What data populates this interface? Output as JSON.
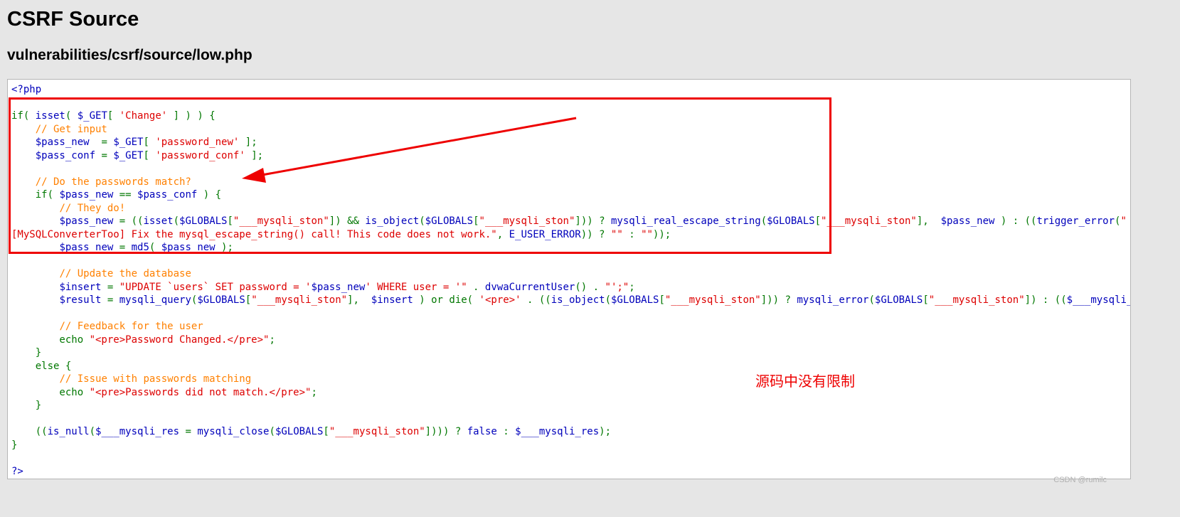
{
  "page": {
    "title": "CSRF Source",
    "subtitle": "vulnerabilities/csrf/source/low.php"
  },
  "code_lines": [
    [
      {
        "t": "<?php",
        "c": "def"
      }
    ],
    [],
    [
      {
        "t": "if( ",
        "c": "kw"
      },
      {
        "t": "isset",
        "c": "def"
      },
      {
        "t": "( ",
        "c": "kw"
      },
      {
        "t": "$_GET",
        "c": "def"
      },
      {
        "t": "[ ",
        "c": "kw"
      },
      {
        "t": "'Change'",
        "c": "str"
      },
      {
        "t": " ] ) ) {",
        "c": "kw"
      }
    ],
    [
      {
        "t": "    ",
        "c": "kw"
      },
      {
        "t": "// Get input",
        "c": "cmt"
      }
    ],
    [
      {
        "t": "    ",
        "c": "kw"
      },
      {
        "t": "$pass_new ",
        "c": "def"
      },
      {
        "t": " = ",
        "c": "kw"
      },
      {
        "t": "$_GET",
        "c": "def"
      },
      {
        "t": "[ ",
        "c": "kw"
      },
      {
        "t": "'password_new'",
        "c": "str"
      },
      {
        "t": " ];",
        "c": "kw"
      }
    ],
    [
      {
        "t": "    ",
        "c": "kw"
      },
      {
        "t": "$pass_conf",
        "c": "def"
      },
      {
        "t": " = ",
        "c": "kw"
      },
      {
        "t": "$_GET",
        "c": "def"
      },
      {
        "t": "[ ",
        "c": "kw"
      },
      {
        "t": "'password_conf'",
        "c": "str"
      },
      {
        "t": " ];",
        "c": "kw"
      }
    ],
    [],
    [
      {
        "t": "    ",
        "c": "kw"
      },
      {
        "t": "// Do the passwords match?",
        "c": "cmt"
      }
    ],
    [
      {
        "t": "    if( ",
        "c": "kw"
      },
      {
        "t": "$pass_new",
        "c": "def"
      },
      {
        "t": " == ",
        "c": "kw"
      },
      {
        "t": "$pass_conf",
        "c": "def"
      },
      {
        "t": " ) {",
        "c": "kw"
      }
    ],
    [
      {
        "t": "        ",
        "c": "kw"
      },
      {
        "t": "// They do!",
        "c": "cmt"
      }
    ],
    [
      {
        "t": "        ",
        "c": "kw"
      },
      {
        "t": "$pass_new",
        "c": "def"
      },
      {
        "t": " = ((",
        "c": "kw"
      },
      {
        "t": "isset",
        "c": "def"
      },
      {
        "t": "(",
        "c": "kw"
      },
      {
        "t": "$GLOBALS",
        "c": "def"
      },
      {
        "t": "[",
        "c": "kw"
      },
      {
        "t": "\"___mysqli_ston\"",
        "c": "str"
      },
      {
        "t": "]) && ",
        "c": "kw"
      },
      {
        "t": "is_object",
        "c": "def"
      },
      {
        "t": "(",
        "c": "kw"
      },
      {
        "t": "$GLOBALS",
        "c": "def"
      },
      {
        "t": "[",
        "c": "kw"
      },
      {
        "t": "\"___mysqli_ston\"",
        "c": "str"
      },
      {
        "t": "])) ? ",
        "c": "kw"
      },
      {
        "t": "mysqli_real_escape_string",
        "c": "def"
      },
      {
        "t": "(",
        "c": "kw"
      },
      {
        "t": "$GLOBALS",
        "c": "def"
      },
      {
        "t": "[",
        "c": "kw"
      },
      {
        "t": "\"___mysqli_ston\"",
        "c": "str"
      },
      {
        "t": "],  ",
        "c": "kw"
      },
      {
        "t": "$pass_new",
        "c": "def"
      },
      {
        "t": " ) : ((",
        "c": "kw"
      },
      {
        "t": "trigger_error",
        "c": "def"
      },
      {
        "t": "(",
        "c": "kw"
      },
      {
        "t": "\"",
        "c": "str"
      }
    ],
    [
      {
        "t": "[MySQLConverterToo] Fix the mysql_escape_string() call! This code does not work.\"",
        "c": "str"
      },
      {
        "t": ", ",
        "c": "kw"
      },
      {
        "t": "E_USER_ERROR",
        "c": "def"
      },
      {
        "t": ")) ? ",
        "c": "kw"
      },
      {
        "t": "\"\"",
        "c": "str"
      },
      {
        "t": " : ",
        "c": "kw"
      },
      {
        "t": "\"\"",
        "c": "str"
      },
      {
        "t": "));",
        "c": "kw"
      }
    ],
    [
      {
        "t": "        ",
        "c": "kw"
      },
      {
        "t": "$pass_new",
        "c": "def"
      },
      {
        "t": " = ",
        "c": "kw"
      },
      {
        "t": "md5",
        "c": "def"
      },
      {
        "t": "( ",
        "c": "kw"
      },
      {
        "t": "$pass_new",
        "c": "def"
      },
      {
        "t": " );",
        "c": "kw"
      }
    ],
    [],
    [
      {
        "t": "        ",
        "c": "kw"
      },
      {
        "t": "// Update the database",
        "c": "cmt"
      }
    ],
    [
      {
        "t": "        ",
        "c": "kw"
      },
      {
        "t": "$insert",
        "c": "def"
      },
      {
        "t": " = ",
        "c": "kw"
      },
      {
        "t": "\"UPDATE `users` SET password = '",
        "c": "str"
      },
      {
        "t": "$pass_new",
        "c": "def"
      },
      {
        "t": "' WHERE user = '\"",
        "c": "str"
      },
      {
        "t": " . ",
        "c": "kw"
      },
      {
        "t": "dvwaCurrentUser",
        "c": "def"
      },
      {
        "t": "() . ",
        "c": "kw"
      },
      {
        "t": "\"';\"",
        "c": "str"
      },
      {
        "t": ";",
        "c": "kw"
      }
    ],
    [
      {
        "t": "        ",
        "c": "kw"
      },
      {
        "t": "$result",
        "c": "def"
      },
      {
        "t": " = ",
        "c": "kw"
      },
      {
        "t": "mysqli_query",
        "c": "def"
      },
      {
        "t": "(",
        "c": "kw"
      },
      {
        "t": "$GLOBALS",
        "c": "def"
      },
      {
        "t": "[",
        "c": "kw"
      },
      {
        "t": "\"___mysqli_ston\"",
        "c": "str"
      },
      {
        "t": "],  ",
        "c": "kw"
      },
      {
        "t": "$insert",
        "c": "def"
      },
      {
        "t": " ) or die( ",
        "c": "kw"
      },
      {
        "t": "'<pre>'",
        "c": "str"
      },
      {
        "t": " . ((",
        "c": "kw"
      },
      {
        "t": "is_object",
        "c": "def"
      },
      {
        "t": "(",
        "c": "kw"
      },
      {
        "t": "$GLOBALS",
        "c": "def"
      },
      {
        "t": "[",
        "c": "kw"
      },
      {
        "t": "\"___mysqli_ston\"",
        "c": "str"
      },
      {
        "t": "])) ? ",
        "c": "kw"
      },
      {
        "t": "mysqli_error",
        "c": "def"
      },
      {
        "t": "(",
        "c": "kw"
      },
      {
        "t": "$GLOBALS",
        "c": "def"
      },
      {
        "t": "[",
        "c": "kw"
      },
      {
        "t": "\"___mysqli_ston\"",
        "c": "str"
      },
      {
        "t": "]) : ((",
        "c": "kw"
      },
      {
        "t": "$___mysqli_res",
        "c": "def"
      }
    ],
    [],
    [
      {
        "t": "        ",
        "c": "kw"
      },
      {
        "t": "// Feedback for the user",
        "c": "cmt"
      }
    ],
    [
      {
        "t": "        echo ",
        "c": "kw"
      },
      {
        "t": "\"<pre>Password Changed.</pre>\"",
        "c": "str"
      },
      {
        "t": ";",
        "c": "kw"
      }
    ],
    [
      {
        "t": "    }",
        "c": "kw"
      }
    ],
    [
      {
        "t": "    else {",
        "c": "kw"
      }
    ],
    [
      {
        "t": "        ",
        "c": "kw"
      },
      {
        "t": "// Issue with passwords matching",
        "c": "cmt"
      }
    ],
    [
      {
        "t": "        echo ",
        "c": "kw"
      },
      {
        "t": "\"<pre>Passwords did not match.</pre>\"",
        "c": "str"
      },
      {
        "t": ";",
        "c": "kw"
      }
    ],
    [
      {
        "t": "    }",
        "c": "kw"
      }
    ],
    [],
    [
      {
        "t": "    ((",
        "c": "kw"
      },
      {
        "t": "is_null",
        "c": "def"
      },
      {
        "t": "(",
        "c": "kw"
      },
      {
        "t": "$___mysqli_res",
        "c": "def"
      },
      {
        "t": " = ",
        "c": "kw"
      },
      {
        "t": "mysqli_close",
        "c": "def"
      },
      {
        "t": "(",
        "c": "kw"
      },
      {
        "t": "$GLOBALS",
        "c": "def"
      },
      {
        "t": "[",
        "c": "kw"
      },
      {
        "t": "\"___mysqli_ston\"",
        "c": "str"
      },
      {
        "t": "]))) ? ",
        "c": "kw"
      },
      {
        "t": "false",
        "c": "def"
      },
      {
        "t": " : ",
        "c": "kw"
      },
      {
        "t": "$___mysqli_res",
        "c": "def"
      },
      {
        "t": ");",
        "c": "kw"
      }
    ],
    [
      {
        "t": "}",
        "c": "kw"
      }
    ],
    [],
    [
      {
        "t": "?>",
        "c": "def"
      }
    ]
  ],
  "annotation": {
    "text": "源码中没有限制",
    "color": "#ee0000"
  },
  "watermark": "CSDN @rumilc",
  "colors": {
    "default": "#0000bb",
    "keyword": "#007700",
    "comment": "#ff8000",
    "string": "#dd0000",
    "background": "#e6e6e6",
    "highlight": "#ee0000"
  }
}
